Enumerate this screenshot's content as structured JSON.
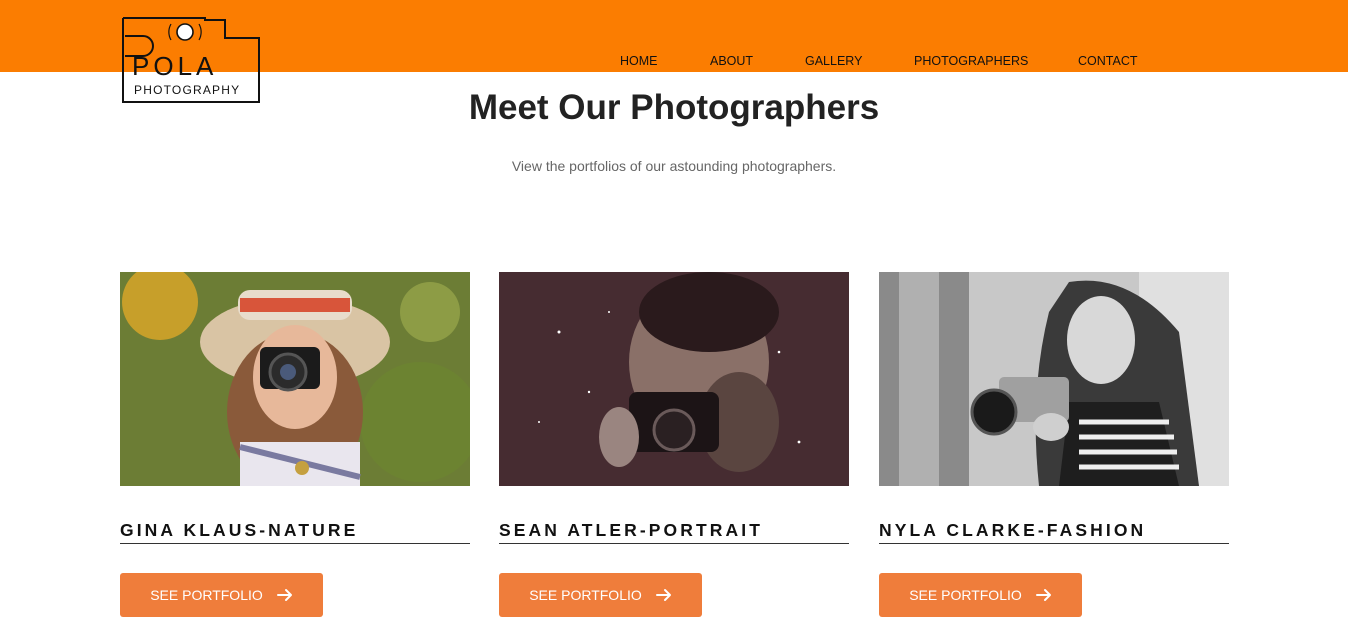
{
  "header": {
    "brand": {
      "wordmark": "POLA",
      "tagline": "PHOTOGRAPHY"
    },
    "nav": [
      {
        "label": "HOME"
      },
      {
        "label": "ABOUT"
      },
      {
        "label": "GALLERY"
      },
      {
        "label": "PHOTOGRAPHERS"
      },
      {
        "label": "CONTACT"
      }
    ]
  },
  "main": {
    "title": "Meet Our Photographers",
    "subtitle": "View the portfolios of our astounding photographers.",
    "photographers": [
      {
        "name": "GINA KLAUS-NATURE",
        "button_label": "SEE PORTFOLIO"
      },
      {
        "name": "SEAN ATLER-PORTRAIT",
        "button_label": "SEE PORTFOLIO"
      },
      {
        "name": "NYLA CLARKE-FASHION",
        "button_label": "SEE PORTFOLIO"
      }
    ]
  },
  "icons": {
    "button_icon": "arrow-right-icon",
    "logo_icon": "camera-icon"
  },
  "colors": {
    "header_bar": "#fb7d01",
    "button": "#ef7d3b",
    "title": "#222222",
    "subtitle": "#666666"
  }
}
